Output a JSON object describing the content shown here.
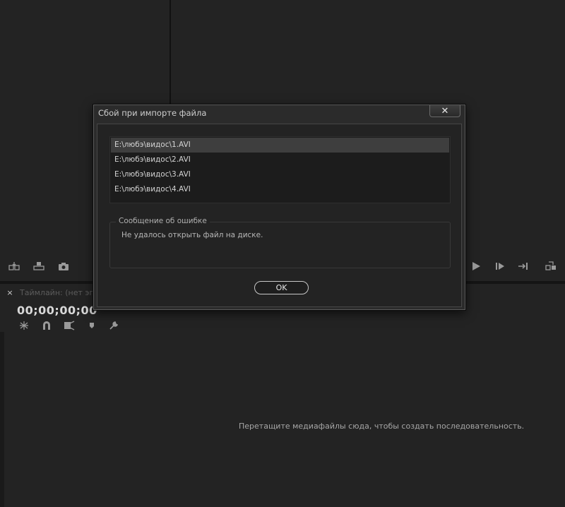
{
  "background": {
    "timeline_tab": {
      "close": "×",
      "label": "Таймлайн: (нет эпи"
    },
    "timecode": "00;00;00;00",
    "drop_hint": "Перетащите медиафайлы сюда, чтобы создать последовательность."
  },
  "dialog": {
    "title": "Сбой при импорте файла",
    "close_label": "✕",
    "files": [
      "E:\\любэ\\видос\\1.AVI",
      "E:\\любэ\\видос\\2.AVI",
      "E:\\любэ\\видос\\3.AVI",
      "E:\\любэ\\видос\\4.AVI"
    ],
    "selected_index": 0,
    "error_group_label": "Сообщение об ошибке",
    "error_message": "Не удалось открыть файл на диске.",
    "ok_label": "OK"
  },
  "icons": {
    "source_toolbar": [
      "insert-icon",
      "overwrite-icon",
      "camera-icon"
    ],
    "program_toolbar": [
      "play-icon",
      "step-forward-icon",
      "go-to-out-icon",
      "export-frame-icon"
    ],
    "timeline_tools": [
      "snap-icon",
      "magnet-icon",
      "link-icon",
      "marker-icon",
      "wrench-icon"
    ]
  },
  "colors": {
    "background": "#232323",
    "dialog": "#2b2b2b",
    "selected_row": "#3e3e3e"
  }
}
